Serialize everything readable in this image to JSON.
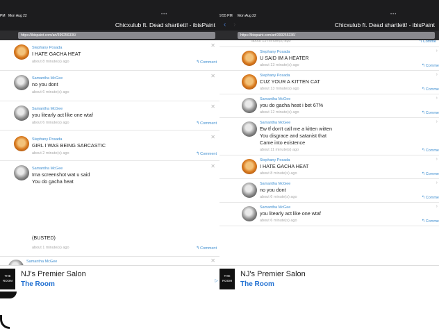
{
  "left": {
    "status_time": "PM",
    "status_date": "Mon Aug 22",
    "status_dots": "•••",
    "title": "Chicxulub ft. Dead shartlett! - ibisPaint",
    "url": "https://ibispaint.com/art/399256336/",
    "reply_label": "Comment",
    "comments": [
      {
        "author": "Stephany Posada",
        "avatar": "orange",
        "lines": [
          "I HATE GACHA HEAT"
        ],
        "meta": "about 8 minute(s) ago",
        "reply": true
      },
      {
        "author": "Samantha McGee",
        "avatar": "grey",
        "lines": [
          "no you dont"
        ],
        "meta": "about 6 minute(s) ago",
        "reply": false
      },
      {
        "author": "Samantha McGee",
        "avatar": "grey",
        "lines": [
          "you litearly act like one wtaf"
        ],
        "meta": "about 6 minute(s) ago",
        "reply": true
      },
      {
        "author": "Stephany Posada",
        "avatar": "orange",
        "lines": [
          "GIRL I WAS BEING SARCASTIC"
        ],
        "meta": "about 2 minute(s) ago",
        "reply": true
      },
      {
        "author": "Samantha McGee",
        "avatar": "grey",
        "lines": [
          "Ima screenshot wat u said",
          "You do gacha heat"
        ],
        "meta": "",
        "reply": false
      }
    ],
    "busted_text": "(BUSTED)",
    "busted_meta": "about 1 minute(s) ago",
    "partial_author": "Samantha McGee"
  },
  "right": {
    "status_time": "9:55 PM",
    "status_date": "Mon Aug 22",
    "status_dots": "•••",
    "title": "Chicxulub ft. Dead shartlett! - ibisPaint",
    "url": "https://ibispaint.com/art/399256336/",
    "reply_label": "Comme",
    "top_meta": "about 13 minute(s) ago",
    "comments": [
      {
        "author": "Stephany Posada",
        "avatar": "orange",
        "lines": [
          "U SAID IM A HEATER"
        ],
        "meta": "about 13 minute(s) ago"
      },
      {
        "author": "Stephany Posada",
        "avatar": "orange",
        "lines": [
          "CUZ YOUR A KITTEN CAT"
        ],
        "meta": "about 13 minute(s) ago"
      },
      {
        "author": "Samantha McGee",
        "avatar": "grey",
        "lines": [
          "you do gacha heat i bet 67%"
        ],
        "meta": "about 12 minute(s) ago"
      },
      {
        "author": "Samantha McGee",
        "avatar": "grey",
        "lines": [
          "Ew tf don't call me a kitten witten",
          "You disgrace and satanist that",
          "Came into existence"
        ],
        "meta": "about 11 minute(s) ago"
      },
      {
        "author": "Stephany Posada",
        "avatar": "orange",
        "lines": [
          "I HATE GACHA HEAT"
        ],
        "meta": "about 8 minute(s) ago"
      },
      {
        "author": "Samantha McGee",
        "avatar": "grey",
        "lines": [
          "no you dont"
        ],
        "meta": "about 6 minute(s) ago"
      },
      {
        "author": "Samantha McGee",
        "avatar": "grey",
        "lines": [
          "you litearly act like one wtaf"
        ],
        "meta": "about 6 minute(s) ago"
      }
    ]
  },
  "ad": {
    "logo_line1": "THE",
    "logo_line2": "ROOM",
    "title": "NJ's Premier Salon",
    "subtitle": "The Room"
  },
  "colors": {
    "accent": "#3e8ed0",
    "header": "#1c1c1e",
    "ad_link": "#1f6fd1"
  },
  "icons": {
    "reply": "reply-arrow-icon",
    "close": "close-icon",
    "chevron": "chevron-right-icon",
    "ad_choices": "ad-choices-icon"
  }
}
